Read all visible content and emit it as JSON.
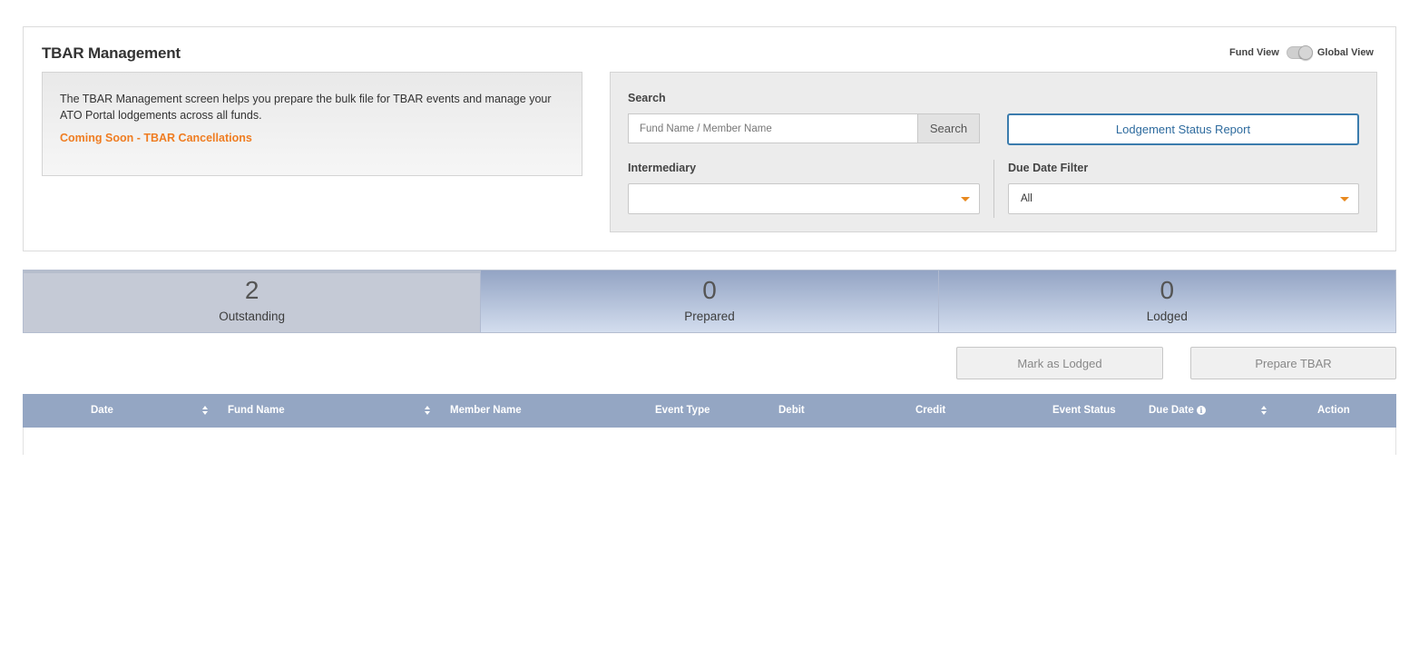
{
  "page_title": "TBAR Management",
  "view_toggle": {
    "left_label": "Fund View",
    "right_label": "Global View"
  },
  "info": {
    "description": "The TBAR Management screen helps you prepare the bulk file for TBAR events and manage your ATO Portal lodgements across all funds.",
    "link": "Coming Soon - TBAR Cancellations"
  },
  "search": {
    "label": "Search",
    "placeholder": "Fund Name / Member Name",
    "button": "Search"
  },
  "lodgement_status_button": "Lodgement Status Report",
  "intermediary": {
    "label": "Intermediary",
    "value": ""
  },
  "due_date_filter": {
    "label": "Due Date Filter",
    "value": "All"
  },
  "status_tabs": [
    {
      "count": "2",
      "label": "Outstanding"
    },
    {
      "count": "0",
      "label": "Prepared"
    },
    {
      "count": "0",
      "label": "Lodged"
    }
  ],
  "actions": {
    "mark_lodged": "Mark as Lodged",
    "prepare": "Prepare TBAR"
  },
  "table": {
    "columns": [
      "Date",
      "Fund Name",
      "Member Name",
      "Event Type",
      "Debit",
      "Credit",
      "Event Status",
      "Due Date",
      "Action"
    ]
  },
  "colors": {
    "accent_orange": "#ef7d22",
    "table_header": "#94a6c3",
    "link_blue": "#2e6b9e"
  }
}
